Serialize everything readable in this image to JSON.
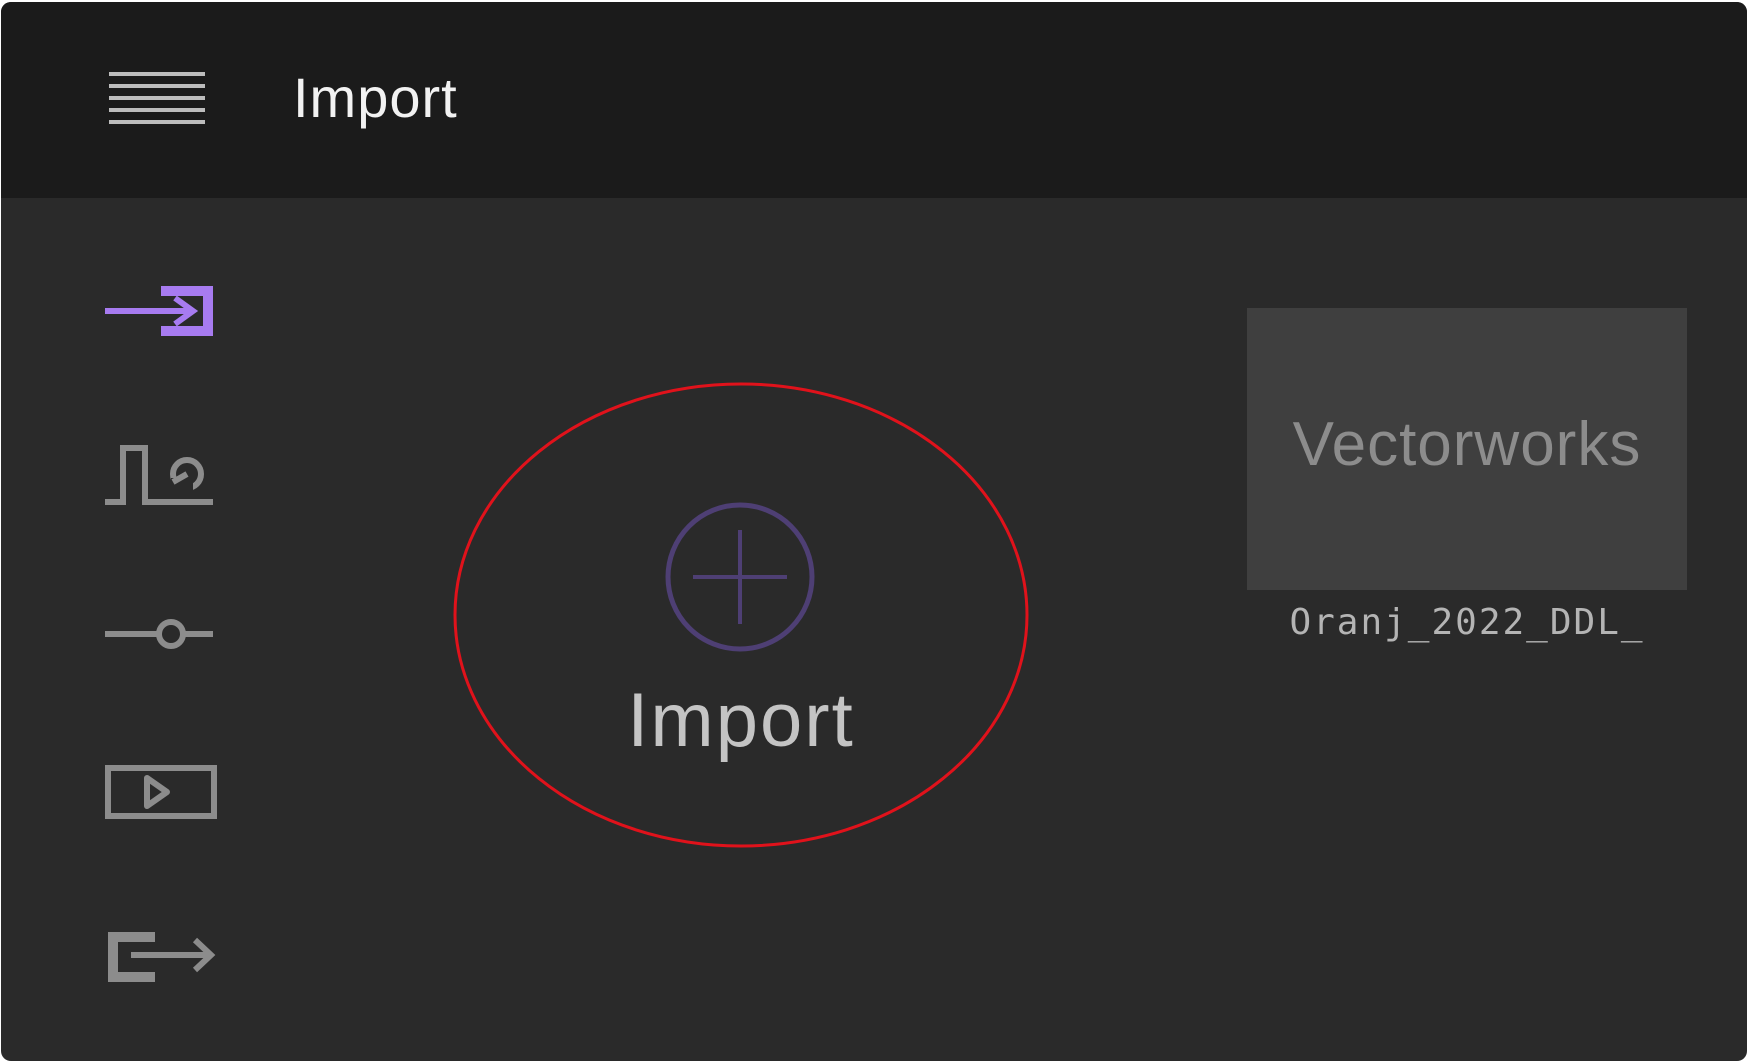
{
  "header": {
    "title": "Import",
    "menu_icon": "hamburger-menu-icon"
  },
  "sidebar": {
    "items": [
      {
        "id": "import",
        "icon": "import-icon",
        "active": true,
        "color": "#a77bf0"
      },
      {
        "id": "patch",
        "icon": "signal-patch-icon",
        "active": false,
        "color": "#8c8c8c"
      },
      {
        "id": "adjust",
        "icon": "slider-icon",
        "active": false,
        "color": "#8c8c8c"
      },
      {
        "id": "preview",
        "icon": "play-preview-icon",
        "active": false,
        "color": "#8c8c8c"
      },
      {
        "id": "export",
        "icon": "export-icon",
        "active": false,
        "color": "#8c8c8c"
      }
    ]
  },
  "main": {
    "import_action": {
      "label": "Import",
      "icon": "plus-circle-icon",
      "icon_color": "#4e3f74",
      "highlight_color": "#e0121b"
    },
    "recent": [
      {
        "thumbnail_text": "Vectorworks",
        "name": "Oranj_2022_DDL_"
      }
    ]
  },
  "colors": {
    "background": "#2a2a2a",
    "topbar": "#1b1b1b",
    "accent": "#a77bf0"
  }
}
